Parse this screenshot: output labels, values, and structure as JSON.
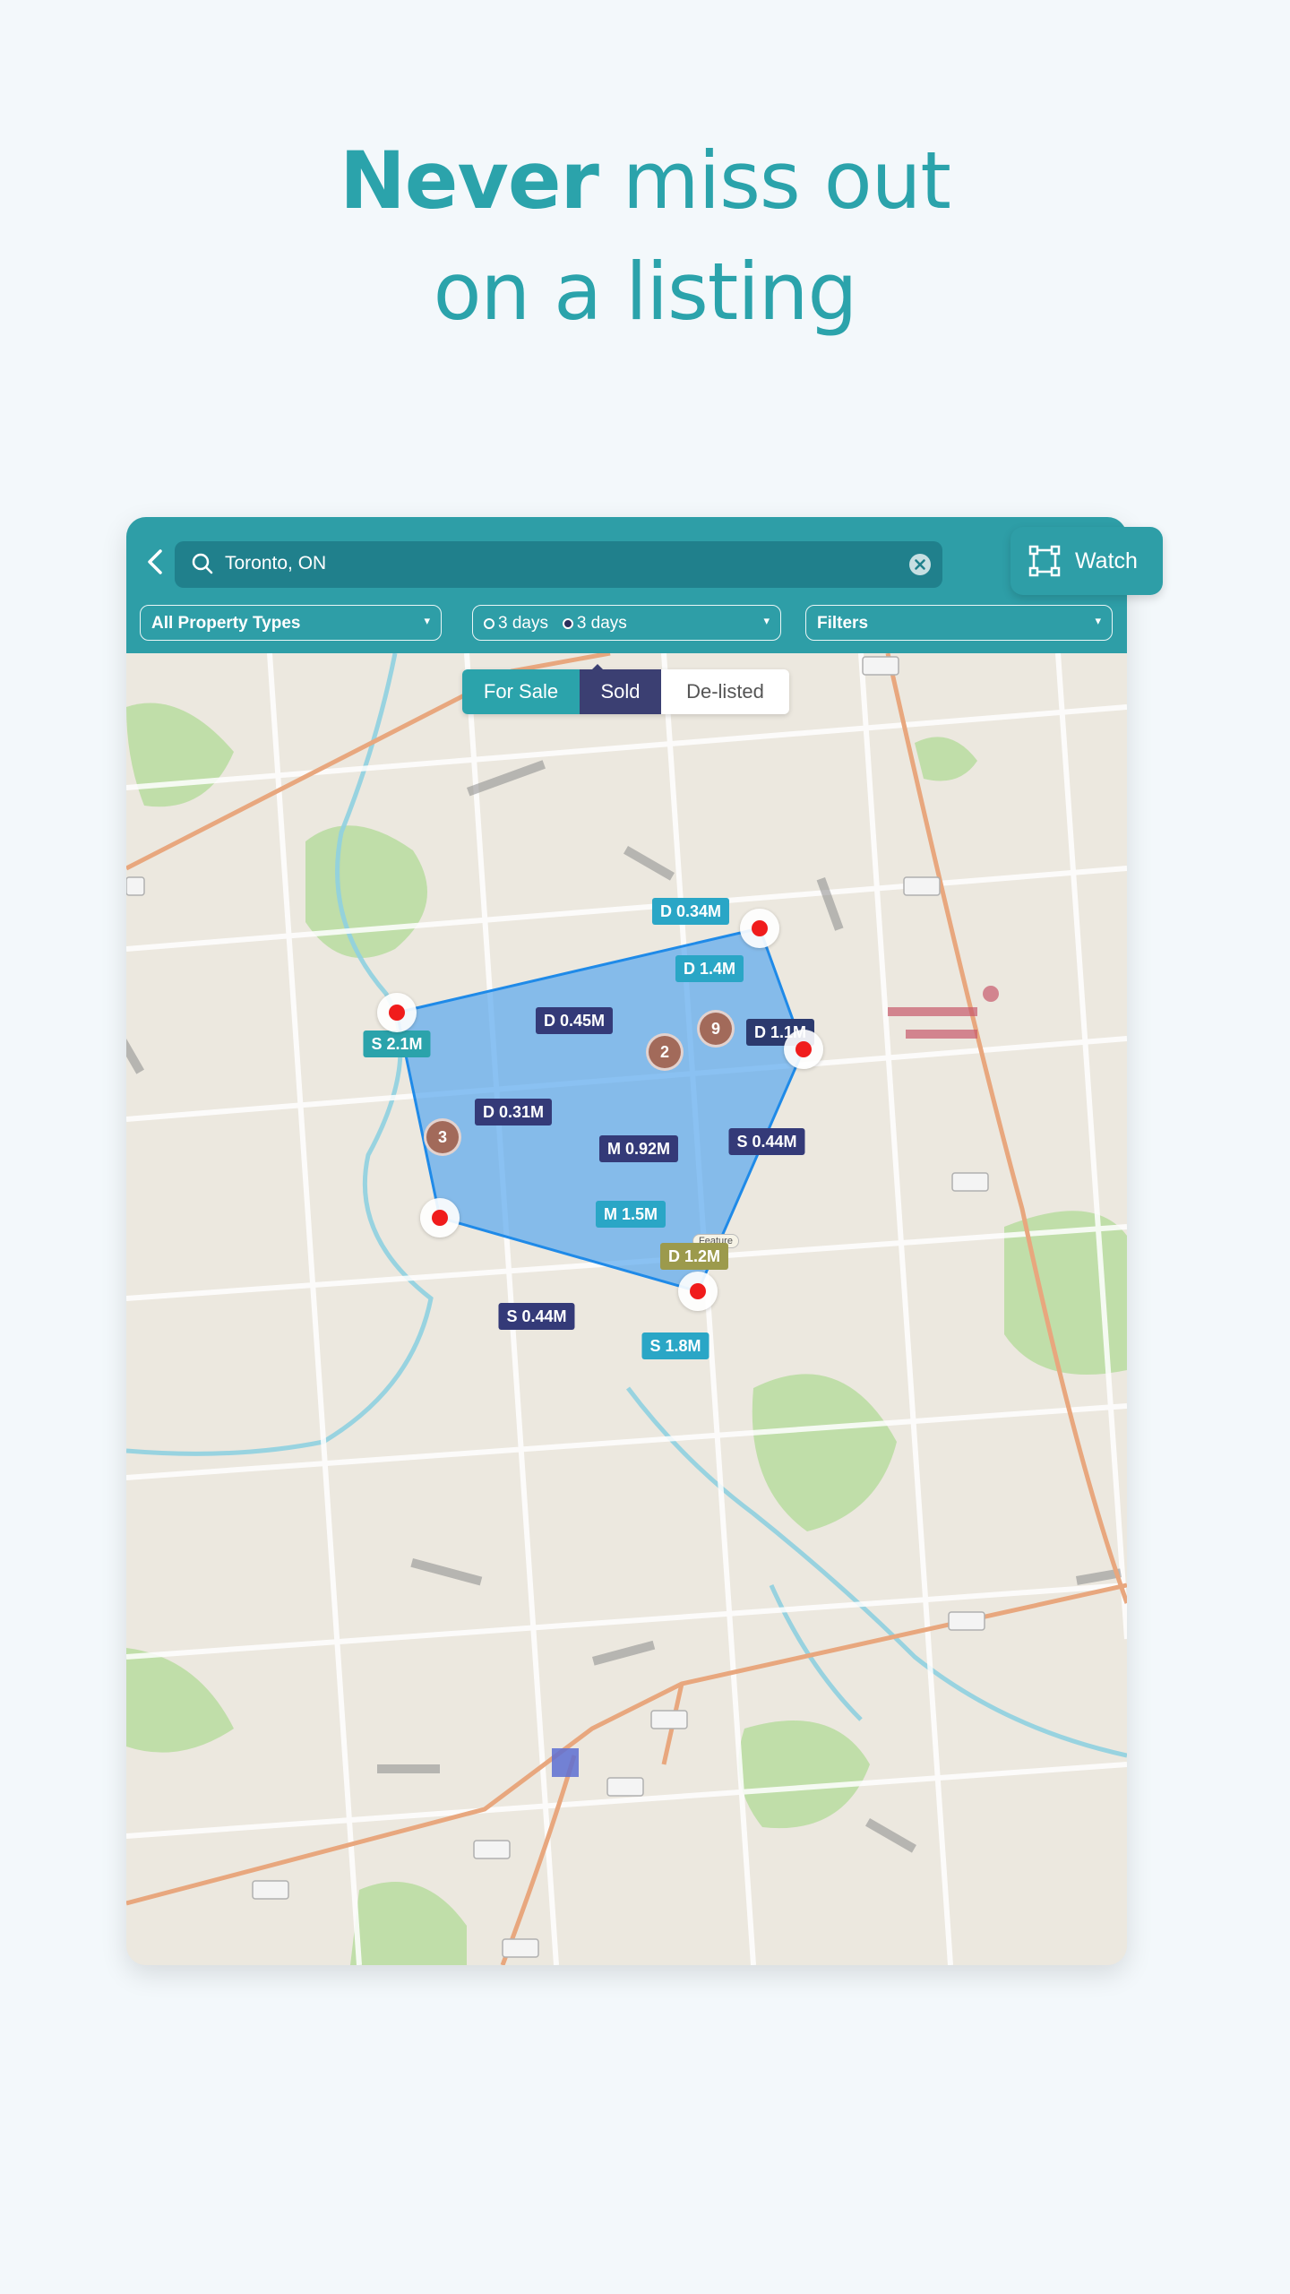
{
  "headline": {
    "bold": "Never",
    "rest": " miss out",
    "line2": "on a listing"
  },
  "search": {
    "value": "Toronto, ON"
  },
  "filters": {
    "property_type": "All Property Types",
    "days_option_a": "3 days",
    "days_option_b": "3 days",
    "filters_label": "Filters"
  },
  "segments": {
    "for_sale": "For Sale",
    "sold": "Sold",
    "delisted": "De-listed"
  },
  "watch": {
    "label": "Watch"
  },
  "price_pins": [
    {
      "label": "D 0.34M",
      "style": "teal"
    },
    {
      "label": "D 1.4M",
      "style": "teal"
    },
    {
      "label": "D 0.45M",
      "style": "dark"
    },
    {
      "label": "D 1.1M",
      "style": "dark"
    },
    {
      "label": "S 2.1M",
      "style": "tealg"
    },
    {
      "label": "D 0.31M",
      "style": "dark"
    },
    {
      "label": "S 0.44M",
      "style": "dark"
    },
    {
      "label": "M 0.92M",
      "style": "dark"
    },
    {
      "label": "M 1.5M",
      "style": "teal"
    },
    {
      "label": "D 1.2M",
      "style": "olive"
    },
    {
      "label": "S 0.44M",
      "style": "dark"
    },
    {
      "label": "S 1.8M",
      "style": "teal"
    }
  ],
  "feature_tag": "Feature",
  "clusters": [
    "9",
    "2",
    "3"
  ],
  "colors": {
    "accent": "#2e9ea7",
    "headline": "#2ba3ab",
    "sold_segment": "#3b3f72",
    "polygon_fill": "#5aa8ee",
    "vertex_dot": "#f01c1c"
  }
}
